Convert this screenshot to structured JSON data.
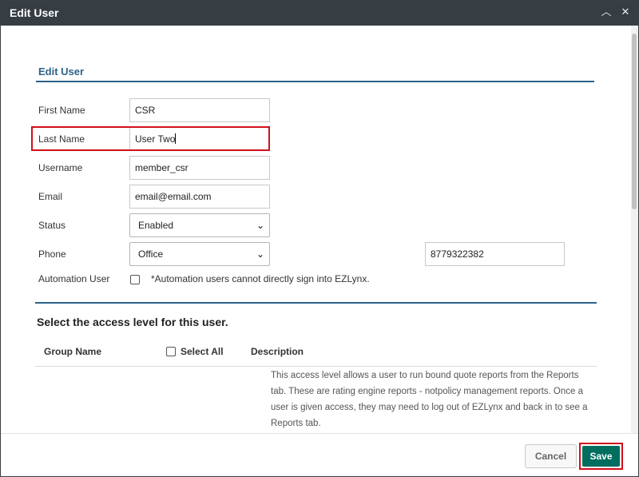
{
  "dialog": {
    "title": "Edit User"
  },
  "form": {
    "section_title": "Edit User",
    "first_name": {
      "label": "First Name",
      "value": "CSR"
    },
    "last_name": {
      "label": "Last Name",
      "value": "User Two"
    },
    "username": {
      "label": "Username",
      "value": "member_csr"
    },
    "email": {
      "label": "Email",
      "value": "email@email.com"
    },
    "status": {
      "label": "Status",
      "value": "Enabled"
    },
    "phone": {
      "label": "Phone",
      "type_value": "Office",
      "number": "8779322382"
    },
    "automation": {
      "label": "Automation User",
      "note": "*Automation users cannot directly sign into EZLynx.",
      "checked": false
    }
  },
  "access": {
    "heading": "Select the access level for this user.",
    "columns": {
      "group_name": "Group Name",
      "select_all": "Select All",
      "description": "Description"
    },
    "rows": [
      {
        "description": "This access level allows a user to run bound quote reports from the Reports tab. These are rating engine reports - notpolicy management reports. Once a user is given access, they may need to log out of EZLynx and back in to see a Reports tab."
      }
    ]
  },
  "footer": {
    "cancel_label": "Cancel",
    "save_label": "Save"
  },
  "icons": {
    "collapse": "chevron-up-icon",
    "close": "close-icon",
    "dropdown": "chevron-down-icon"
  },
  "colors": {
    "titlebar": "#363d43",
    "accent": "#2d6288",
    "save": "#006e5f",
    "highlight": "#d0101b"
  }
}
